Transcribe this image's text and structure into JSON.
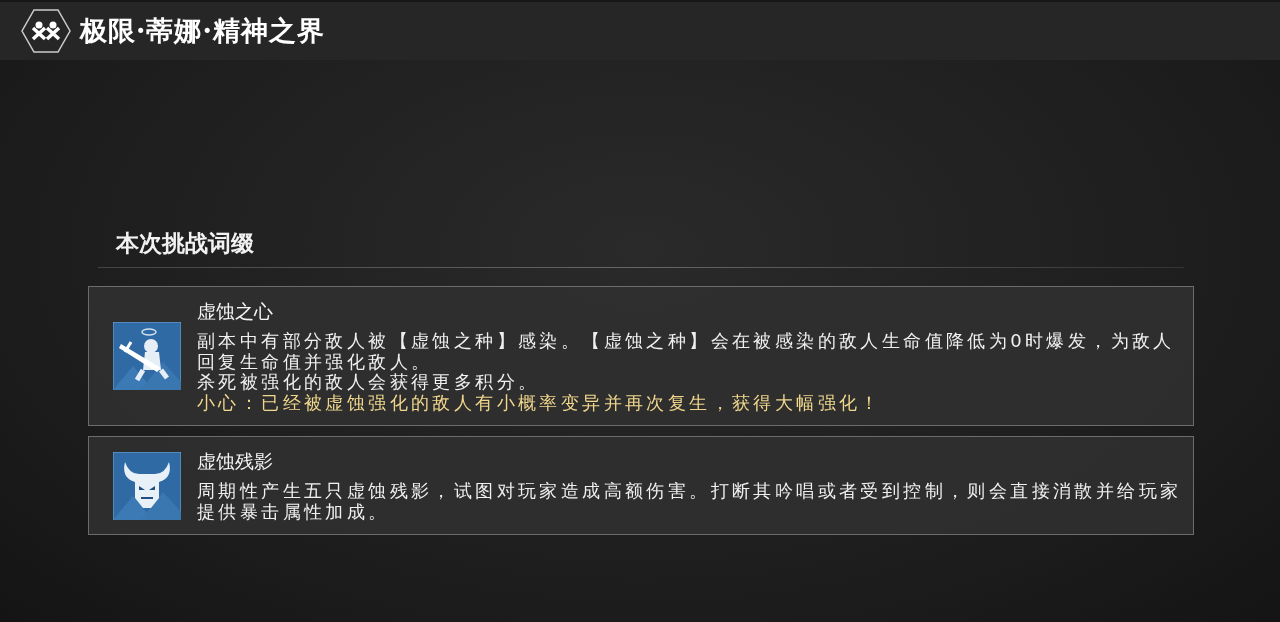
{
  "header": {
    "title": "极限·蒂娜·精神之界"
  },
  "section": {
    "title": "本次挑战词缀",
    "affixes": [
      {
        "name": "虚蚀之心",
        "kind": "sword",
        "lines": [
          {
            "kind": "normal",
            "text": "副本中有部分敌人被【虚蚀之种】感染。【虚蚀之种】会在被感染的敌人生命值降低为0时爆发，为敌人回复生命值并强化敌人。"
          },
          {
            "kind": "normal",
            "text": "杀死被强化的敌人会获得更多积分。"
          },
          {
            "kind": "warning",
            "text": "小心：已经被虚蚀强化的敌人有小概率变异并再次复生，获得大幅强化！"
          }
        ]
      },
      {
        "name": "虚蚀残影",
        "kind": "demon",
        "lines": [
          {
            "kind": "normal",
            "text": "周期性产生五只虚蚀残影，试图对玩家造成高额伤害。打断其吟唱或者受到控制，则会直接消散并给玩家提供暴击属性加成。"
          }
        ]
      }
    ]
  }
}
